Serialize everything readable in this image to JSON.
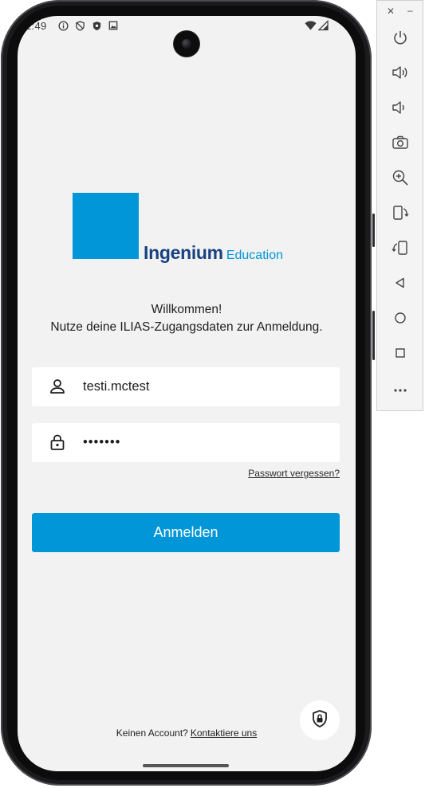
{
  "status_bar": {
    "time": "2:49"
  },
  "logo": {
    "brand": "Ingenium",
    "sub": "Education"
  },
  "welcome": {
    "title": "Willkommen!",
    "subtitle": "Nutze deine ILIAS-Zugangsdaten zur Anmeldung."
  },
  "login_form": {
    "username_value": "testi.mctest",
    "password_value": "•••••••",
    "forgot_label": "Passwort vergessen?",
    "submit_label": "Anmelden"
  },
  "footer": {
    "no_account_text": "Keinen Account?",
    "contact_link": "Kontaktiere uns"
  },
  "emulator_panel": {
    "close_label": "✕",
    "minimize_label": "–",
    "controls": [
      "power-icon",
      "volume-up-icon",
      "volume-down-icon",
      "camera-icon",
      "zoom-in-icon",
      "rotate-left-icon",
      "rotate-right-icon",
      "back-icon",
      "home-icon",
      "overview-icon",
      "more-icon"
    ]
  },
  "colors": {
    "brand_blue": "#0096d8",
    "brand_navy": "#17427f",
    "screen_bg": "#f2f2f2"
  }
}
